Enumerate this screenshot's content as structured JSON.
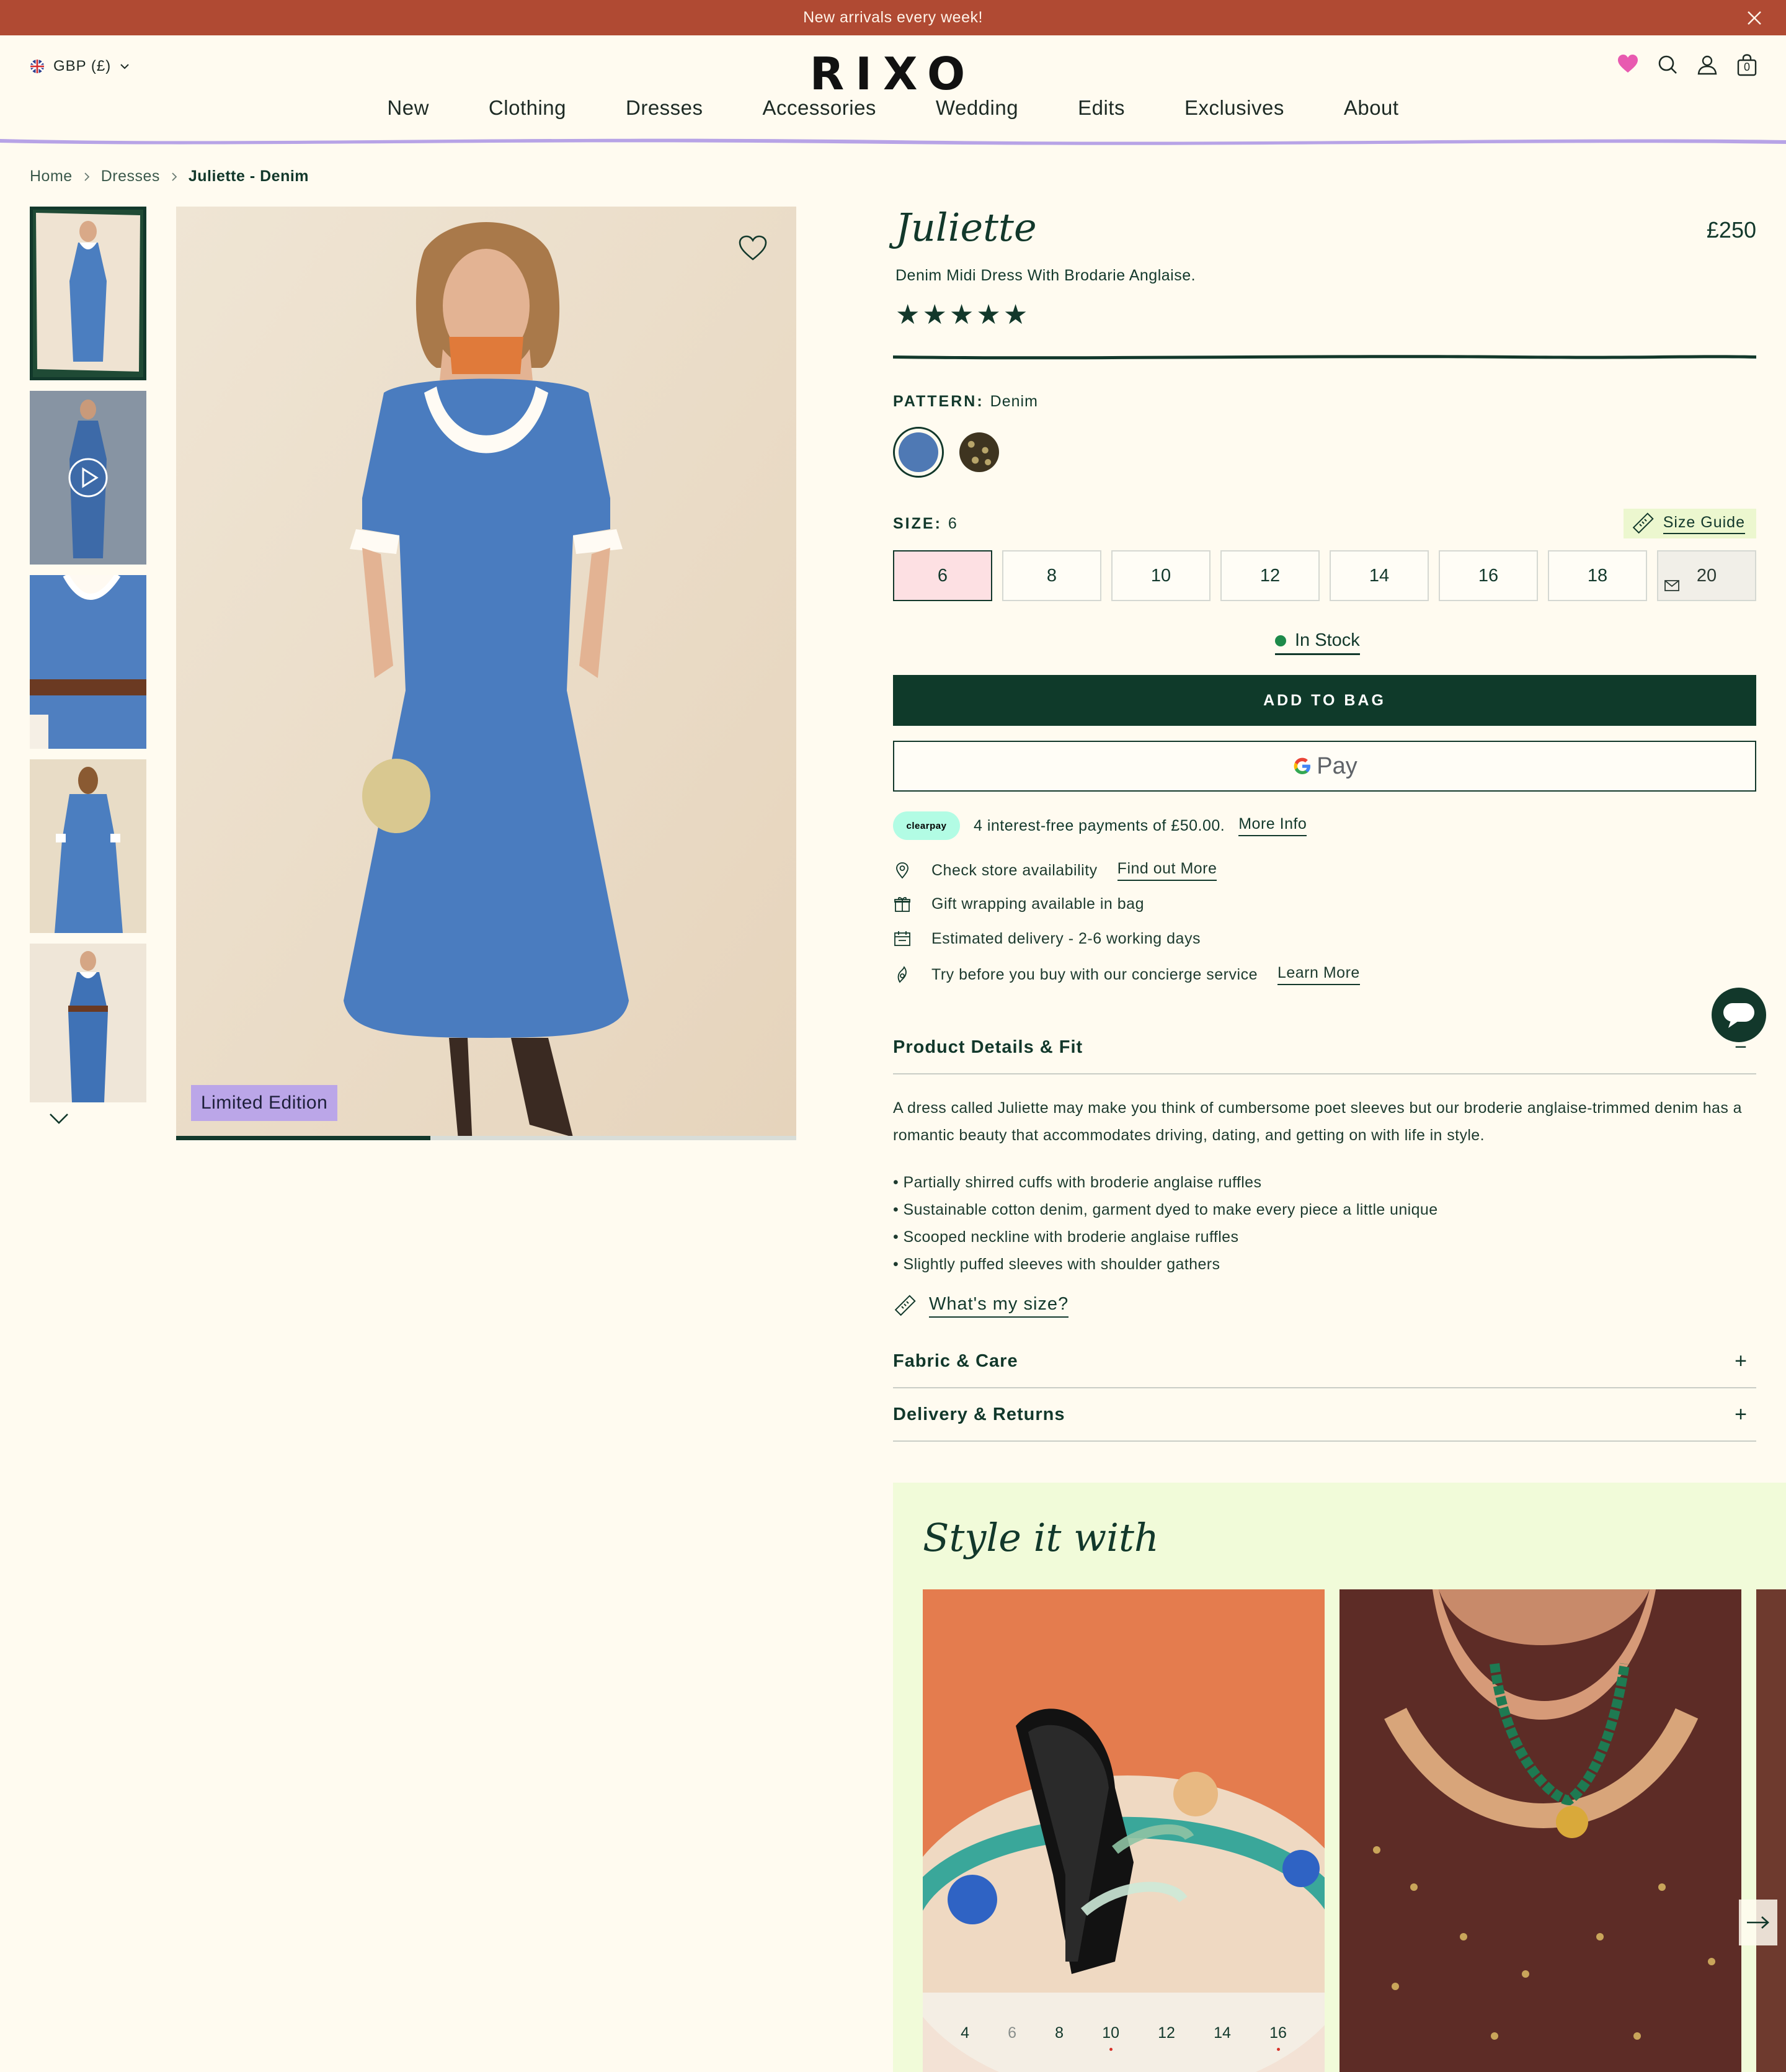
{
  "announcement": {
    "text": "New arrivals every week!"
  },
  "header": {
    "currency": "GBP (£)",
    "logo": "RIXO",
    "nav": [
      "New",
      "Clothing",
      "Dresses",
      "Accessories",
      "Wedding",
      "Edits",
      "Exclusives",
      "About"
    ],
    "bag_count": "0"
  },
  "breadcrumb": [
    "Home",
    "Dresses",
    "Juliette - Denim"
  ],
  "gallery": {
    "badge": "Limited Edition",
    "thumb_count": 5,
    "active_index": 0,
    "progress": 0.41
  },
  "product": {
    "title": "Juliette",
    "price": "£250",
    "subtitle": "Denim Midi Dress With Brodarie Anglaise.",
    "rating_stars": 5,
    "pattern_label": "PATTERN:",
    "pattern_value": "Denim",
    "swatches": [
      {
        "name": "Denim",
        "color": "#4f79b4",
        "selected": true
      },
      {
        "name": "Leopard",
        "color": "#5a4c2c",
        "selected": false
      }
    ],
    "size_label": "SIZE:",
    "size_value": "6",
    "size_guide": "Size  Guide",
    "sizes": [
      "6",
      "8",
      "10",
      "12",
      "14",
      "16",
      "18",
      "20"
    ],
    "selected_size": "6",
    "out_of_stock_sizes": [
      "20"
    ],
    "stock": "In Stock",
    "add_to_bag": "ADD TO BAG",
    "gpay": "Pay"
  },
  "clearpay": {
    "badge": "clearpay",
    "text": "4 interest-free payments of £50.00.",
    "link": "More Info"
  },
  "info": [
    {
      "icon": "location-pin-icon",
      "text": "Check store availability",
      "link": "Find out More"
    },
    {
      "icon": "gift-icon",
      "text": "Gift wrapping available in bag",
      "link": ""
    },
    {
      "icon": "delivery-box-icon",
      "text": "Estimated delivery - 2-6 working days",
      "link": ""
    },
    {
      "icon": "concierge-icon",
      "text": "Try before you buy with our concierge service",
      "link": "Learn More"
    }
  ],
  "accordion": {
    "details_title": "Product Details & Fit",
    "details_toggle": "−",
    "description": "A dress called Juliette may make you think of cumbersome poet sleeves but our broderie anglaise-trimmed denim has a romantic beauty that accommodates driving, dating, and getting on with life in style.",
    "bullets": [
      "Partially shirred cuffs with broderie anglaise ruffles",
      "Sustainable cotton denim, garment dyed to make every piece a little unique",
      "Scooped neckline with broderie anglaise ruffles",
      "Slightly puffed sleeves with shoulder gathers"
    ],
    "whats_my_size": "What's my size?",
    "fabric_title": "Fabric & Care",
    "delivery_title": "Delivery & Returns",
    "plus": "+"
  },
  "style_it_with": {
    "title": "Style it with",
    "card1_sizes": [
      "4",
      "6",
      "8",
      "10",
      "12",
      "14",
      "16"
    ]
  },
  "colors": {
    "announce_bg": "#b04a33",
    "page_bg": "#fffbf0",
    "brand_green": "#0f3a2a",
    "accent_lilac": "#bba6e8",
    "heart_pink": "#e85ab0",
    "style_bg": "#f1fbd9"
  }
}
